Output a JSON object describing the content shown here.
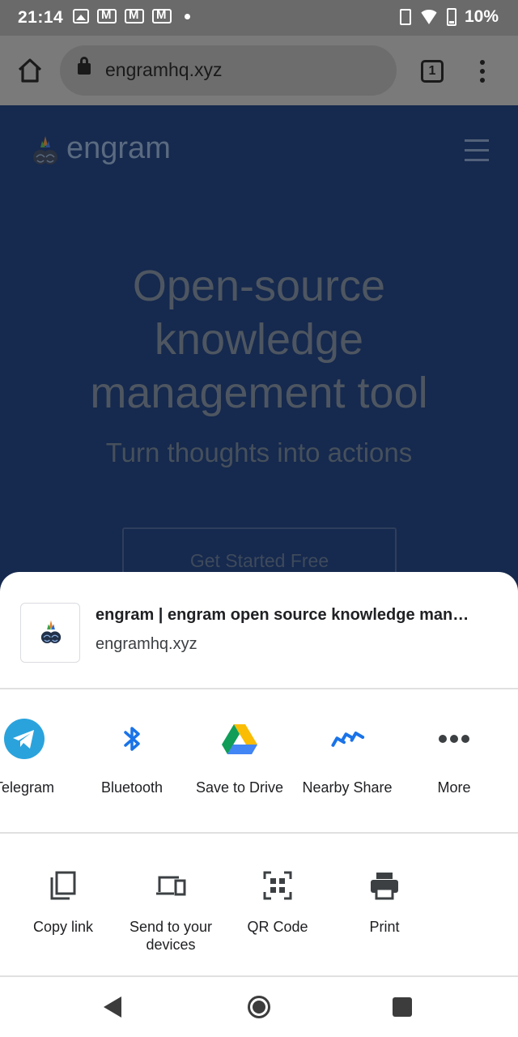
{
  "status_bar": {
    "time": "21:14",
    "battery": "10%",
    "icons": [
      "image-icon",
      "gmail-icon",
      "gmail-icon",
      "gmail-icon",
      "dot-icon",
      "vibrate-icon",
      "wifi-icon",
      "battery-charging-icon"
    ]
  },
  "browser": {
    "url": "engramhq.xyz",
    "tab_count": "1"
  },
  "page": {
    "brand": "engram",
    "hero_line1": "Open-source",
    "hero_line2": "knowledge",
    "hero_line3": "management tool",
    "subtitle": "Turn thoughts into actions",
    "cta": "Get Started Free"
  },
  "share_sheet": {
    "preview_title": "engram | engram open source knowledge man…",
    "preview_url": "engramhq.xyz",
    "apps": [
      {
        "label": "Telegram",
        "icon": "telegram-icon"
      },
      {
        "label": "Bluetooth",
        "icon": "bluetooth-icon"
      },
      {
        "label": "Save to Drive",
        "icon": "drive-icon"
      },
      {
        "label": "Nearby Share",
        "icon": "nearby-share-icon"
      },
      {
        "label": "More",
        "icon": "more-icon"
      }
    ],
    "actions": [
      {
        "label": "Copy link",
        "icon": "copy-icon"
      },
      {
        "label": "Send to your devices",
        "icon": "devices-icon"
      },
      {
        "label": "QR Code",
        "icon": "qr-code-icon"
      },
      {
        "label": "Print",
        "icon": "print-icon"
      }
    ]
  },
  "colors": {
    "page_bg_dimmed": "#16294e",
    "status_bar_dimmed": "#6a6a6a",
    "telegram": "#2aa3dd",
    "bluetooth": "#1a73e8"
  }
}
